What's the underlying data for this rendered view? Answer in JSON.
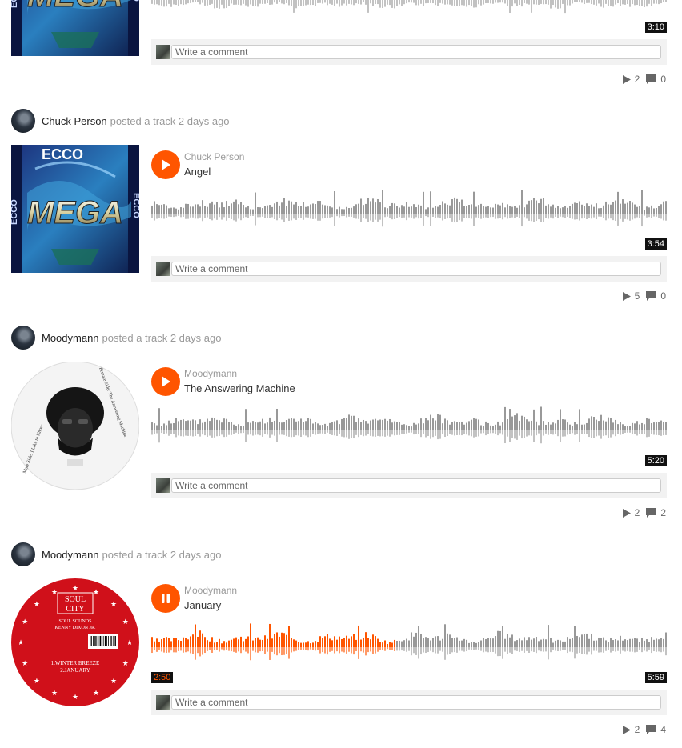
{
  "commenter": {
    "placeholder": "Write a comment"
  },
  "tracks": [
    {
      "poster": "",
      "action": "",
      "artist": "",
      "title": "",
      "art": "ecco-mega",
      "state": "paused",
      "elapsed": "",
      "duration": "3:10",
      "played_fraction": 0,
      "plays": "2",
      "comments": "0"
    },
    {
      "poster": "Chuck Person",
      "action": "posted a track 2 days ago",
      "artist": "Chuck Person",
      "title": "Angel",
      "art": "ecco-mega",
      "state": "paused",
      "elapsed": "",
      "duration": "3:54",
      "played_fraction": 0,
      "plays": "5",
      "comments": "0"
    },
    {
      "poster": "Moodymann",
      "action": "posted a track 2 days ago",
      "artist": "Moodymann",
      "title": "The Answering Machine",
      "art": "answering-machine",
      "state": "paused",
      "elapsed": "",
      "duration": "5:20",
      "played_fraction": 0,
      "plays": "2",
      "comments": "2"
    },
    {
      "poster": "Moodymann",
      "action": "posted a track 2 days ago",
      "artist": "Moodymann",
      "title": "January",
      "art": "soul-city",
      "state": "playing",
      "elapsed": "2:50",
      "duration": "5:59",
      "played_fraction": 0.474,
      "plays": "2",
      "comments": "4"
    }
  ],
  "art_text": {
    "ecco_top": "ECCO",
    "ecco_mega": "MEGA",
    "ecco_side": "ECCO",
    "soul_city_top": "SOUL",
    "soul_city_bottom": "CITY",
    "soul_sounds": "SOUL SOUNDS",
    "soul_artist": "KENNY DIXON JR.",
    "soul_tracks": "1.WINTER BREEZE",
    "soul_tracks2": "2.JANUARY",
    "am_side": "Male Side: I Like to Know",
    "am_side2": "Female Side: The Answering Machine"
  },
  "colors": {
    "accent": "#ff5500",
    "waveform": "#999999",
    "badge": "#111111"
  },
  "icons": {
    "play": "play-icon",
    "pause": "pause-icon",
    "plays": "plays-icon",
    "comments": "comment-icon"
  }
}
